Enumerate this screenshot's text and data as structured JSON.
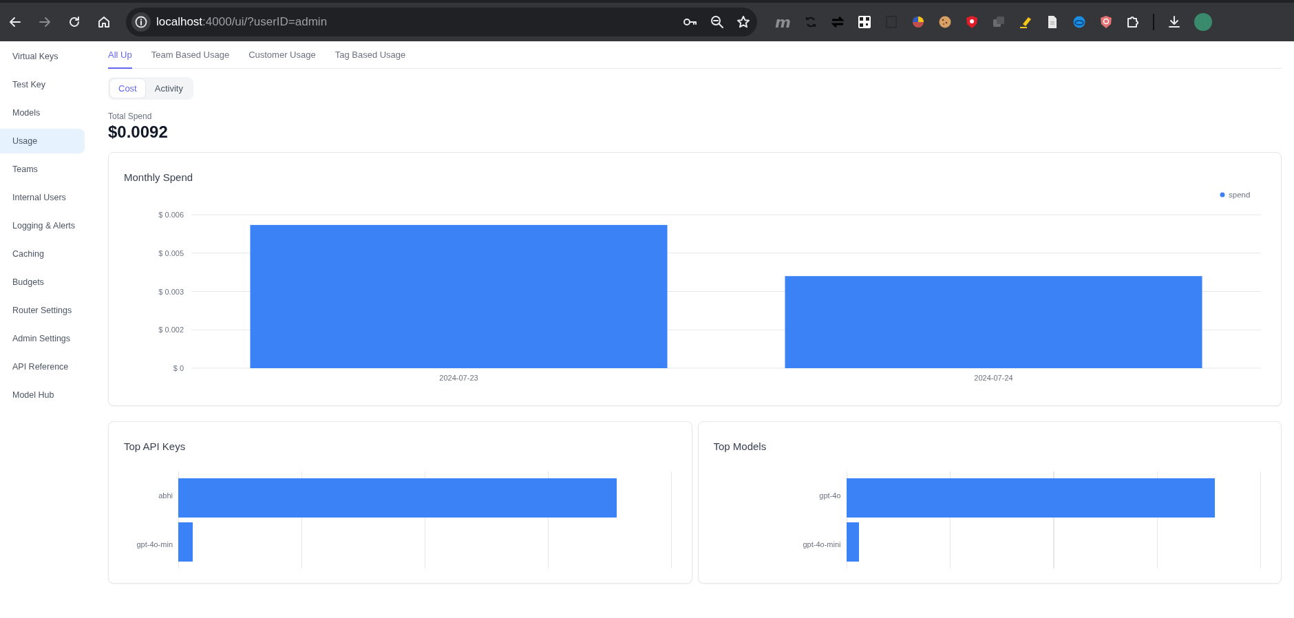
{
  "browser": {
    "url_host": "localhost",
    "url_path": ":4000/ui/?userID=admin",
    "extension_glyph": "m"
  },
  "sidebar": {
    "items": [
      {
        "label": "Virtual Keys",
        "selected": false
      },
      {
        "label": "Test Key",
        "selected": false
      },
      {
        "label": "Models",
        "selected": false
      },
      {
        "label": "Usage",
        "selected": true
      },
      {
        "label": "Teams",
        "selected": false
      },
      {
        "label": "Internal Users",
        "selected": false
      },
      {
        "label": "Logging & Alerts",
        "selected": false
      },
      {
        "label": "Caching",
        "selected": false
      },
      {
        "label": "Budgets",
        "selected": false
      },
      {
        "label": "Router Settings",
        "selected": false
      },
      {
        "label": "Admin Settings",
        "selected": false
      },
      {
        "label": "API Reference",
        "selected": false
      },
      {
        "label": "Model Hub",
        "selected": false
      }
    ]
  },
  "tabs": [
    {
      "label": "All Up",
      "selected": true
    },
    {
      "label": "Team Based Usage",
      "selected": false
    },
    {
      "label": "Customer Usage",
      "selected": false
    },
    {
      "label": "Tag Based Usage",
      "selected": false
    }
  ],
  "view_toggle": [
    {
      "label": "Cost",
      "selected": true
    },
    {
      "label": "Activity",
      "selected": false
    }
  ],
  "total_spend": {
    "label": "Total Spend",
    "value": "$0.0092"
  },
  "monthly_spend": {
    "title": "Monthly Spend",
    "chart_data": {
      "type": "bar",
      "categories": [
        "2024-07-23",
        "2024-07-24"
      ],
      "series": [
        {
          "name": "spend",
          "color": "#3b82f6",
          "values": [
            0.0056,
            0.0036
          ]
        }
      ],
      "ylim": [
        0,
        0.006
      ],
      "grid": true,
      "yticks": [
        {
          "value": 0,
          "label": "$ 0"
        },
        {
          "value": 0.0015,
          "label": "$ 0.002"
        },
        {
          "value": 0.003,
          "label": "$ 0.003"
        },
        {
          "value": 0.0045,
          "label": "$ 0.005"
        },
        {
          "value": 0.006,
          "label": "$ 0.006"
        }
      ]
    }
  },
  "top_api_keys": {
    "title": "Top API Keys",
    "labels": [
      "abhi",
      "gpt-4o-min"
    ]
  },
  "top_models": {
    "title": "Top Models",
    "labels": [
      "gpt-4o",
      "gpt-4o-mini"
    ]
  }
}
